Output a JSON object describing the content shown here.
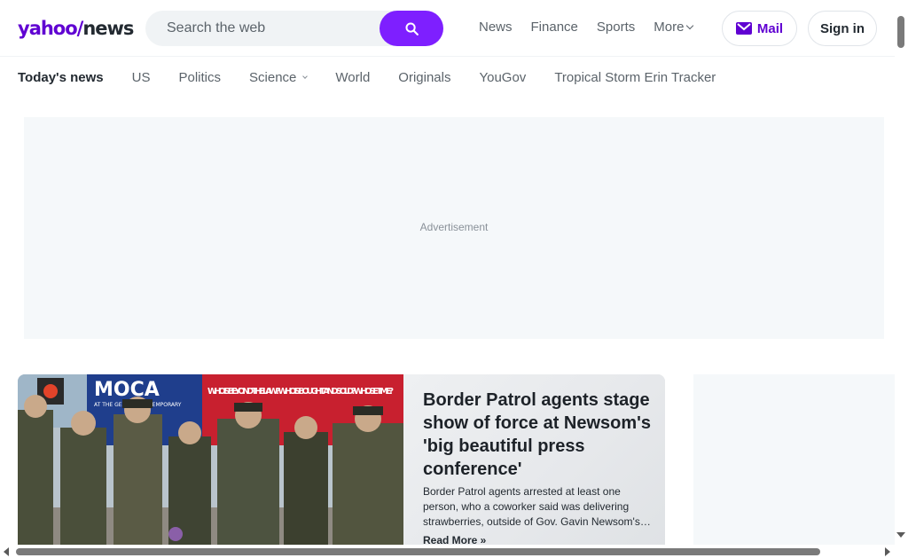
{
  "brand": {
    "logo_text_a": "yahoo",
    "logo_slash": "/",
    "logo_text_b": "news",
    "accent": "#6001d2",
    "search_button_color": "#7e1fff"
  },
  "search": {
    "placeholder": "Search the web",
    "value": ""
  },
  "topnav": {
    "items": [
      "News",
      "Finance",
      "Sports"
    ],
    "more_label": "More"
  },
  "account": {
    "mail_label": "Mail",
    "signin_label": "Sign in"
  },
  "subnav": {
    "active": "Today's news",
    "items": [
      "US",
      "Politics"
    ],
    "science": "Science",
    "items_after": [
      "World",
      "Originals",
      "YouGov",
      "Tropical Storm Erin Tracker"
    ]
  },
  "ad": {
    "label": "Advertisement"
  },
  "story": {
    "title": "Border Patrol agents stage show of force at Newsom's 'big beautiful press conference'",
    "description": "Border Patrol agents arrested at least one person, who a coworker said was delivering strawberries, outside of Gov. Gavin Newsom's…",
    "read_more": "Read More »",
    "image_banner_text": "MOCA",
    "image_banner_sub": "AT THE GEFFEN CONTEMPORARY",
    "image_banner_question": "WHO IS BEYOND THE LAW? WHO IS BOUGHT AND SOLD? WHOSE TIME?"
  },
  "icons": {
    "search": "search-icon",
    "mail": "mail-icon",
    "chevron": "chevron-down-icon"
  }
}
